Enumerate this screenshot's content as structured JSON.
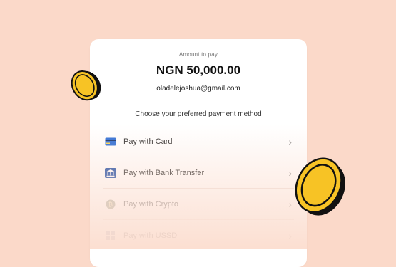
{
  "payment": {
    "amount_label": "Amount to pay",
    "amount": "NGN 50,000.00",
    "email": "oladelejoshua@gmail.com",
    "prompt": "Choose your preferred payment method"
  },
  "options": [
    {
      "label": "Pay with Card",
      "icon": "card-icon"
    },
    {
      "label": "Pay with Bank Transfer",
      "icon": "bank-icon"
    },
    {
      "label": "Pay with Crypto",
      "icon": "crypto-icon"
    },
    {
      "label": "Pay with USSD",
      "icon": "ussd-icon"
    }
  ],
  "colors": {
    "background": "#fbd9c9",
    "coin": "#f7c325",
    "coin_edge": "#111111"
  }
}
